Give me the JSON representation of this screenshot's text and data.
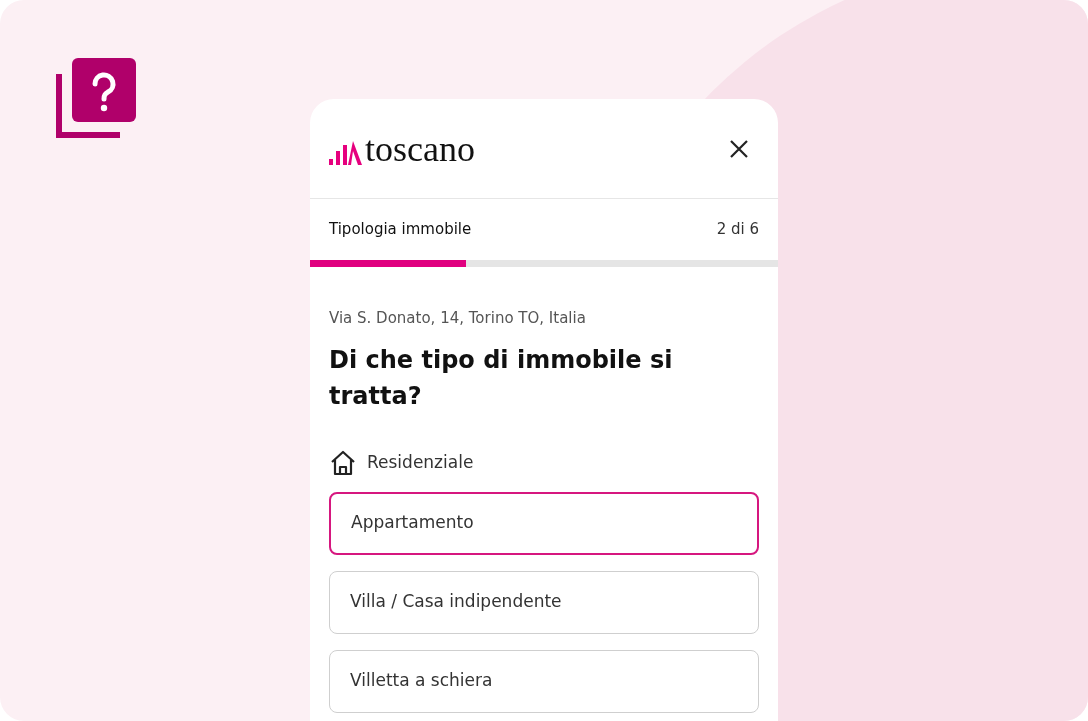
{
  "logo": {
    "text": "toscano"
  },
  "step": {
    "title": "Tipologia immobile",
    "counter": "2 di 6",
    "level": 0.333
  },
  "address": "Via S. Donato, 14, Torino TO, Italia",
  "question": "Di che tipo di immobile si tratta?",
  "category": {
    "label": "Residenziale"
  },
  "options": [
    {
      "label": "Appartamento",
      "selected": true
    },
    {
      "label": "Villa / Casa indipendente",
      "selected": false
    },
    {
      "label": "Villetta a schiera",
      "selected": false
    }
  ]
}
